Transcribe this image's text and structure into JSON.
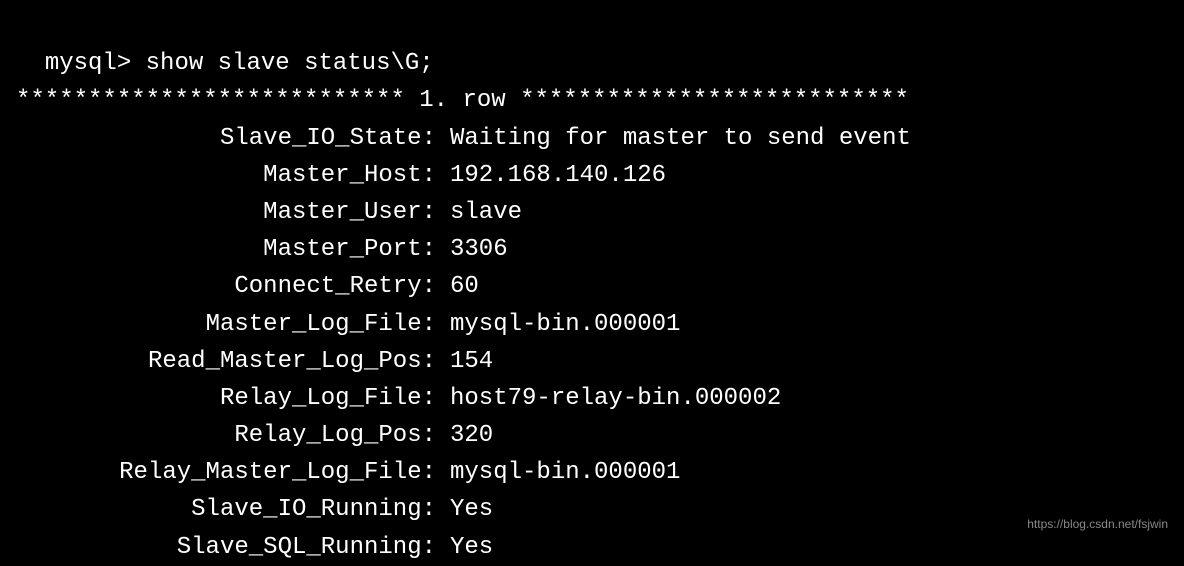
{
  "prompt": "mysql> ",
  "command": "show slave status\\G;",
  "row_header": "*************************** 1. row ***************************",
  "fields": [
    {
      "label": "Slave_IO_State:",
      "value": "Waiting for master to send event"
    },
    {
      "label": "Master_Host:",
      "value": "192.168.140.126"
    },
    {
      "label": "Master_User:",
      "value": "slave"
    },
    {
      "label": "Master_Port:",
      "value": "3306"
    },
    {
      "label": "Connect_Retry:",
      "value": "60"
    },
    {
      "label": "Master_Log_File:",
      "value": "mysql-bin.000001"
    },
    {
      "label": "Read_Master_Log_Pos:",
      "value": "154"
    },
    {
      "label": "Relay_Log_File:",
      "value": "host79-relay-bin.000002"
    },
    {
      "label": "Relay_Log_Pos:",
      "value": "320"
    },
    {
      "label": "Relay_Master_Log_File:",
      "value": "mysql-bin.000001"
    },
    {
      "label": "Slave_IO_Running:",
      "value": "Yes"
    },
    {
      "label": "Slave_SQL_Running:",
      "value": "Yes"
    }
  ],
  "watermark": "https://blog.csdn.net/fsjwin"
}
